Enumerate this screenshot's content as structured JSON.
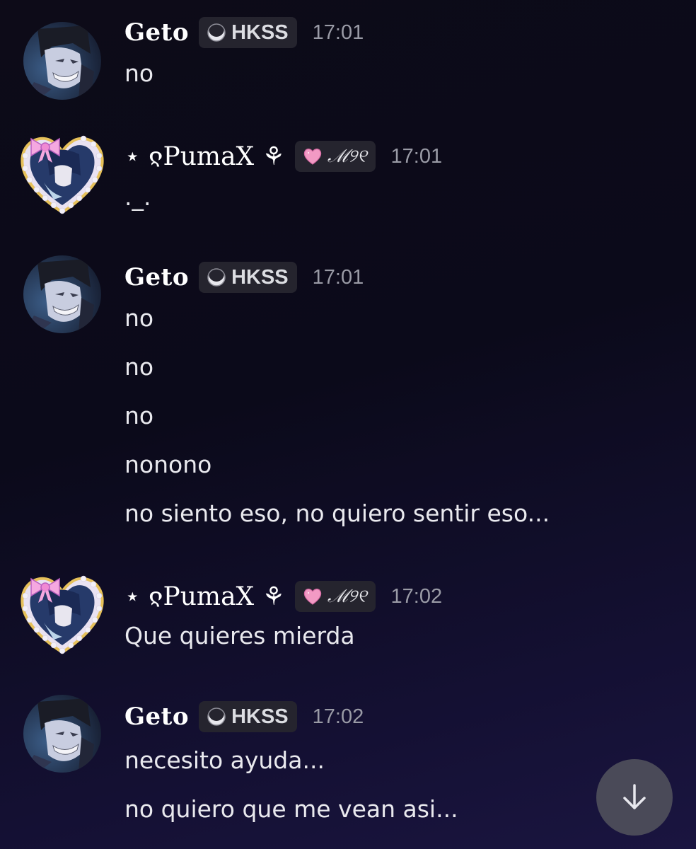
{
  "messages": [
    {
      "author": "Geto",
      "tag": "HKSS",
      "time": "17:01",
      "lines": [
        "no"
      ]
    },
    {
      "author": "⋆ ჺPumaX ⚘",
      "tag": "ℳ୨୧",
      "time": "17:01",
      "lines": [
        "._."
      ]
    },
    {
      "author": "Geto",
      "tag": "HKSS",
      "time": "17:01",
      "lines": [
        "no",
        "no",
        "no",
        "nonono",
        "no siento eso, no quiero sentir eso..."
      ]
    },
    {
      "author": "⋆ ჺPumaX ⚘",
      "tag": "ℳ୨୧",
      "time": "17:02",
      "lines": [
        "Que quieres mierda"
      ]
    },
    {
      "author": "Geto",
      "tag": "HKSS",
      "time": "17:02",
      "lines": [
        "necesito ayuda...",
        "no quiero que me vean asi..."
      ]
    }
  ],
  "icons": {
    "geto_tag_icon": "moon-icon",
    "pumax_tag_icon": "pink-heart-icon",
    "scroll": "arrow-down-icon"
  },
  "colors": {
    "background_top": "#0d0b18",
    "background_bottom": "#1a1540",
    "tag_bg": "#25242e",
    "timestamp": "#9a9ba6",
    "message_text": "#e9e9ee",
    "heart_pink": "#f29ac4"
  }
}
